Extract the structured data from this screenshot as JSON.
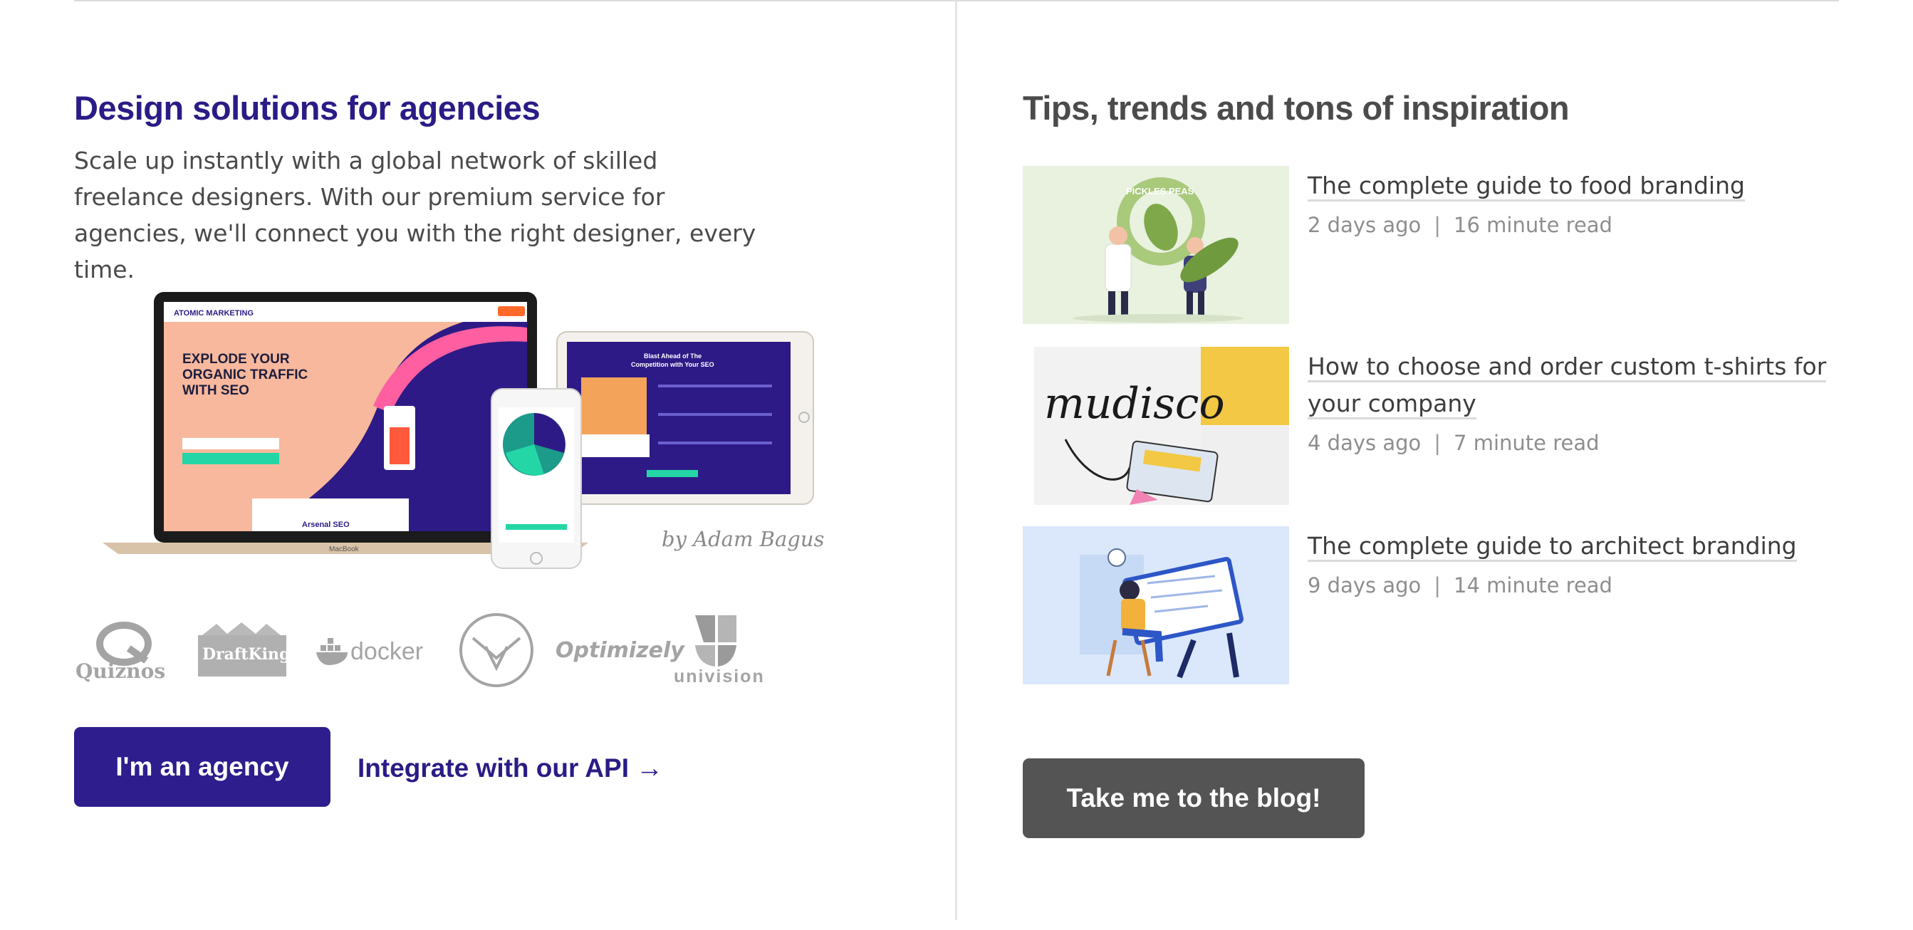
{
  "agencies": {
    "heading": "Design solutions for agencies",
    "description": "Scale up instantly with a global network of skilled freelance designers. With our premium service for agencies, we'll connect you with the right designer, every time.",
    "mockup": {
      "brand": "ATOMIC MARKETING",
      "headline": "EXPLODE YOUR ORGANIC TRAFFIC WITH SEO",
      "tablet_title": "Blast Ahead of The Competition with Your SEO",
      "laptop_model": "MacBook",
      "laptop_footer": "Arsenal SEO"
    },
    "byline": "by Adam Bagus",
    "logos": [
      "Quiznos",
      "DraftKings",
      "docker",
      "Lufthansa",
      "Optimizely",
      "univision"
    ],
    "primary_button": "I'm an agency",
    "api_link": "Integrate with our API",
    "api_arrow": "→"
  },
  "blog": {
    "heading": "Tips, trends and tons of inspiration",
    "posts": [
      {
        "title": "The complete guide to food branding",
        "age": "2 days ago",
        "read": "16 minute read",
        "thumb_label": "PICKLES PEAS"
      },
      {
        "title": "How to choose and order custom t-shirts for your company",
        "age": "4 days ago",
        "read": "7 minute read",
        "thumb_label": "mudisco"
      },
      {
        "title": "The complete guide to architect branding",
        "age": "9 days ago",
        "read": "14 minute read",
        "thumb_label": ""
      }
    ],
    "separator": "|",
    "button": "Take me to the blog!"
  },
  "colors": {
    "brand_purple": "#2d1d8d",
    "blog_button": "#545454",
    "logo_gray": "#a4a4a4"
  }
}
